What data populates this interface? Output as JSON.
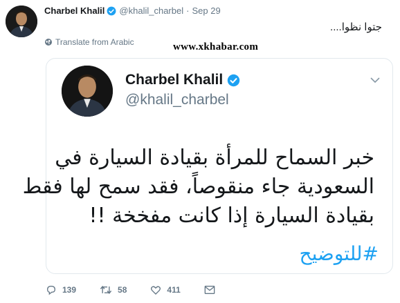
{
  "tweet": {
    "author_name": "Charbel Khalil",
    "author_handle": "@khalil_charbel",
    "separator": "·",
    "date": "Sep 29",
    "text": "جتوا نظوا....",
    "translate_label": "Translate from Arabic",
    "watermark": "www.xkhabar.com"
  },
  "quote": {
    "name": "Charbel Khalil",
    "handle": "@khalil_charbel",
    "lines": [
      "خبر السماح للمرأة بقيادة السيارة في",
      "السعودية جاء منقوصاً، فقد سمح لها فقط",
      "بقيادة السيارة إذا كانت مفخخة !!"
    ],
    "hashtag": "#للتوضيح"
  },
  "actions": {
    "replies": "139",
    "retweets": "58",
    "likes": "411"
  },
  "colors": {
    "verified": "#1da1f2",
    "hashtag": "#1da1f2",
    "muted": "#657786"
  },
  "icons": [
    "verified-badge-icon",
    "globe-icon",
    "chevron-down-icon",
    "reply-icon",
    "retweet-icon",
    "like-icon",
    "message-icon"
  ]
}
